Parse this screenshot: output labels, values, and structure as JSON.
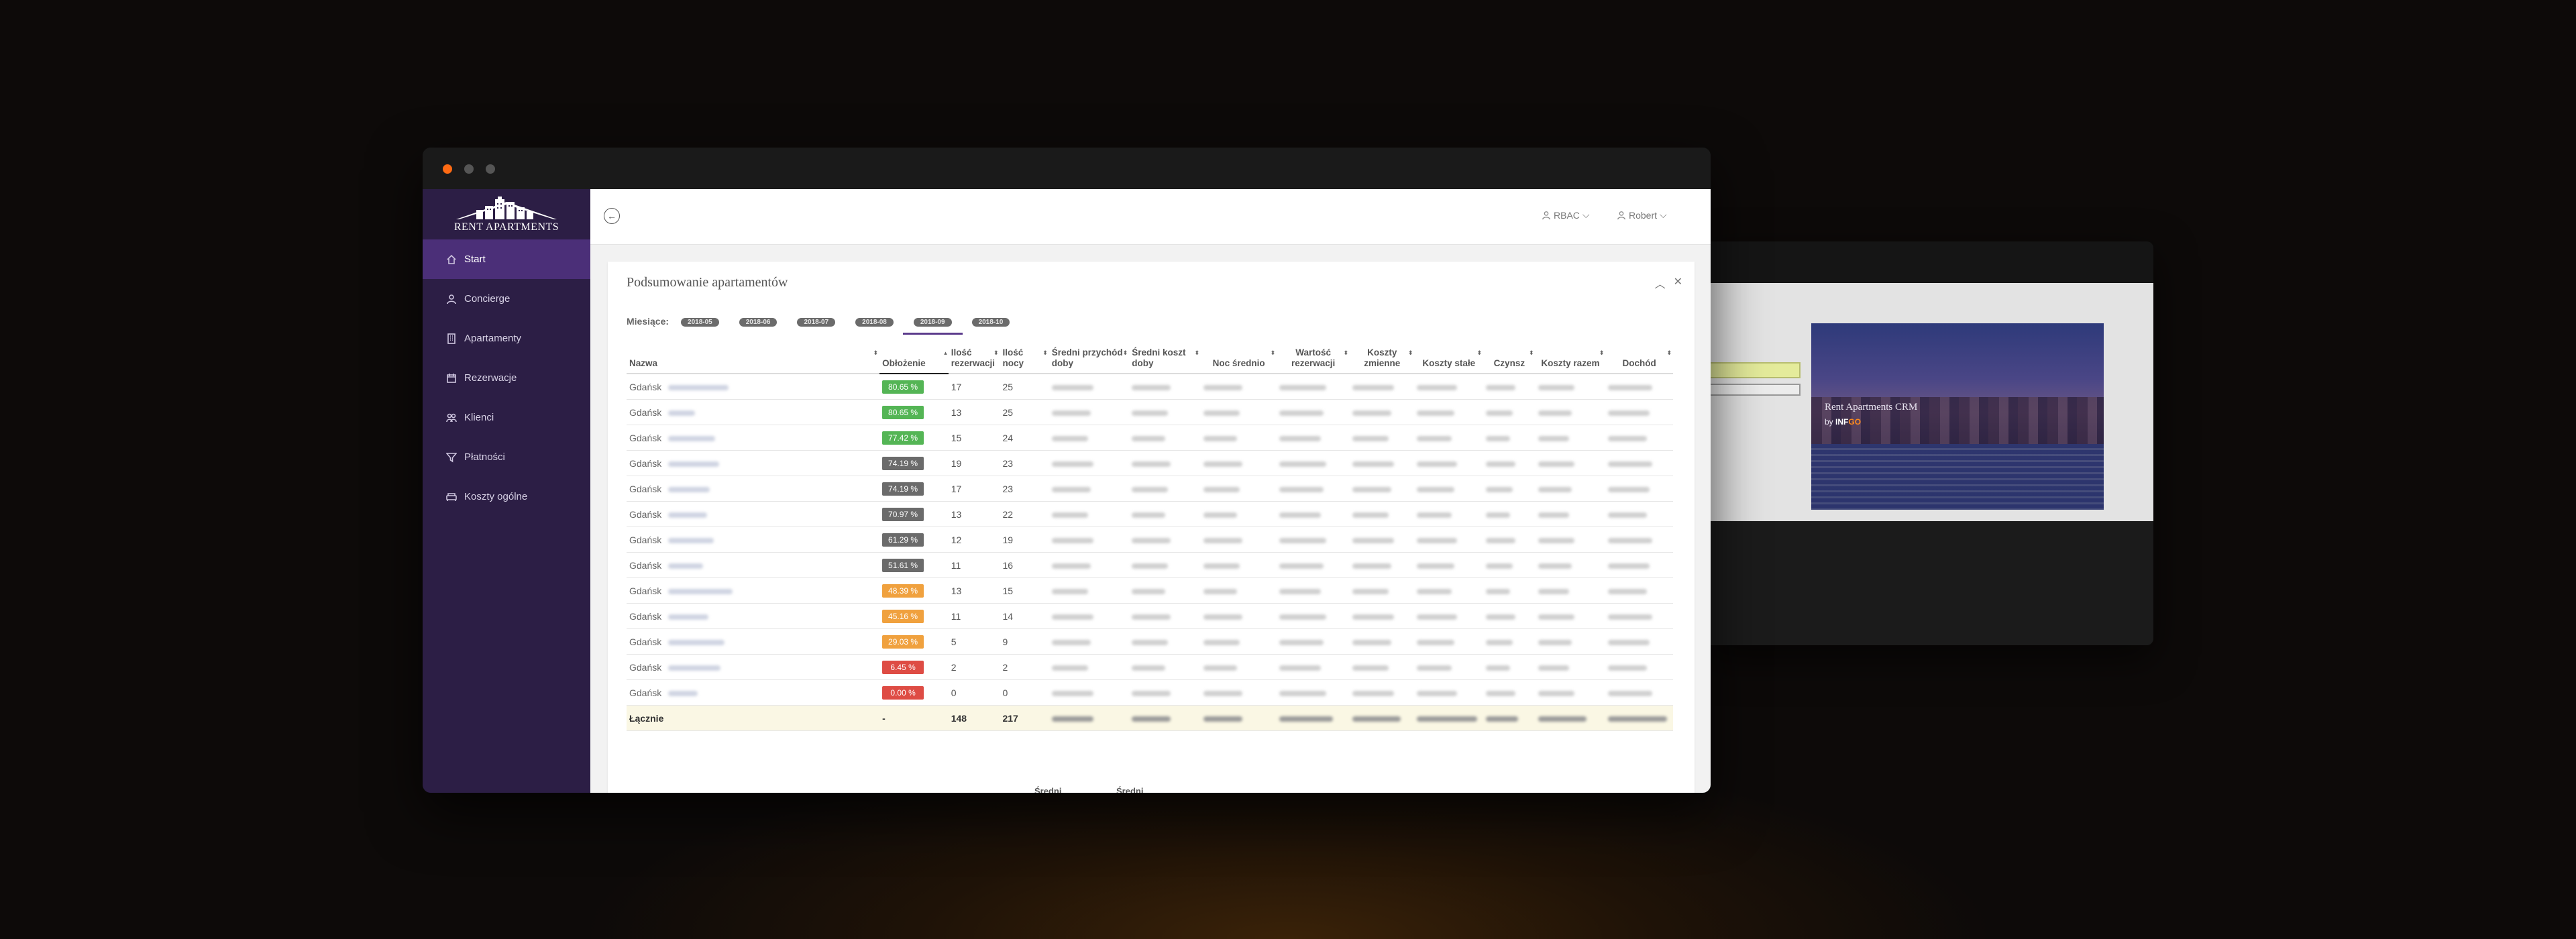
{
  "app": {
    "brand": "RENT APARTMENTS"
  },
  "back_window": {
    "title": "Rent Apartments CRM",
    "by_prefix": "by",
    "by_brand_1": "INF",
    "by_brand_2": "GO"
  },
  "sidebar": {
    "items": [
      {
        "label": "Start",
        "icon": "home-icon",
        "active": true
      },
      {
        "label": "Concierge",
        "icon": "person-icon"
      },
      {
        "label": "Apartamenty",
        "icon": "building-icon"
      },
      {
        "label": "Rezerwacje",
        "icon": "calendar-icon"
      },
      {
        "label": "Klienci",
        "icon": "people-icon"
      },
      {
        "label": "Płatności",
        "icon": "filter-icon"
      },
      {
        "label": "Koszty ogólne",
        "icon": "sofa-icon"
      }
    ]
  },
  "topbar": {
    "role_menu": "RBAC",
    "user_menu": "Robert"
  },
  "card": {
    "title": "Podsumowanie apartamentów",
    "months_label": "Miesiące:",
    "months": [
      "2018-05",
      "2018-06",
      "2018-07",
      "2018-08",
      "2018-09",
      "2018-10"
    ],
    "active_month": "2018-09"
  },
  "table": {
    "headers": [
      "Nazwa",
      "Obłożenie",
      "Ilość rezerwacji",
      "Ilość nocy",
      "Średni przychód doby",
      "Średni koszt doby",
      "Noc średnio",
      "Wartość rezerwacji",
      "Koszty zmienne",
      "Koszty stałe",
      "Czynsz",
      "Koszty razem",
      "Dochód"
    ],
    "rows": [
      {
        "city": "Gdańsk",
        "occ": "80.65 %",
        "color": "#54b555",
        "res": "17",
        "nights": "25"
      },
      {
        "city": "Gdańsk",
        "occ": "80.65 %",
        "color": "#54b555",
        "res": "13",
        "nights": "25"
      },
      {
        "city": "Gdańsk",
        "occ": "77.42 %",
        "color": "#54b555",
        "res": "15",
        "nights": "24"
      },
      {
        "city": "Gdańsk",
        "occ": "74.19 %",
        "color": "#6b6b6b",
        "res": "19",
        "nights": "23"
      },
      {
        "city": "Gdańsk",
        "occ": "74.19 %",
        "color": "#6b6b6b",
        "res": "17",
        "nights": "23"
      },
      {
        "city": "Gdańsk",
        "occ": "70.97 %",
        "color": "#6b6b6b",
        "res": "13",
        "nights": "22"
      },
      {
        "city": "Gdańsk",
        "occ": "61.29 %",
        "color": "#6b6b6b",
        "res": "12",
        "nights": "19"
      },
      {
        "city": "Gdańsk",
        "occ": "51.61 %",
        "color": "#6b6b6b",
        "res": "11",
        "nights": "16"
      },
      {
        "city": "Gdańsk",
        "occ": "48.39 %",
        "color": "#f0a13e",
        "res": "13",
        "nights": "15"
      },
      {
        "city": "Gdańsk",
        "occ": "45.16 %",
        "color": "#f0a13e",
        "res": "11",
        "nights": "14"
      },
      {
        "city": "Gdańsk",
        "occ": "29.03 %",
        "color": "#f0a13e",
        "res": "5",
        "nights": "9"
      },
      {
        "city": "Gdańsk",
        "occ": "6.45 %",
        "color": "#de4c44",
        "res": "2",
        "nights": "2"
      },
      {
        "city": "Gdańsk",
        "occ": "0.00 %",
        "color": "#de4c44",
        "res": "0",
        "nights": "0"
      }
    ],
    "total": {
      "label": "Łącznie",
      "occ": "-",
      "res": "148",
      "nights": "217"
    },
    "next_headers": [
      "Średni",
      "Średni"
    ]
  }
}
